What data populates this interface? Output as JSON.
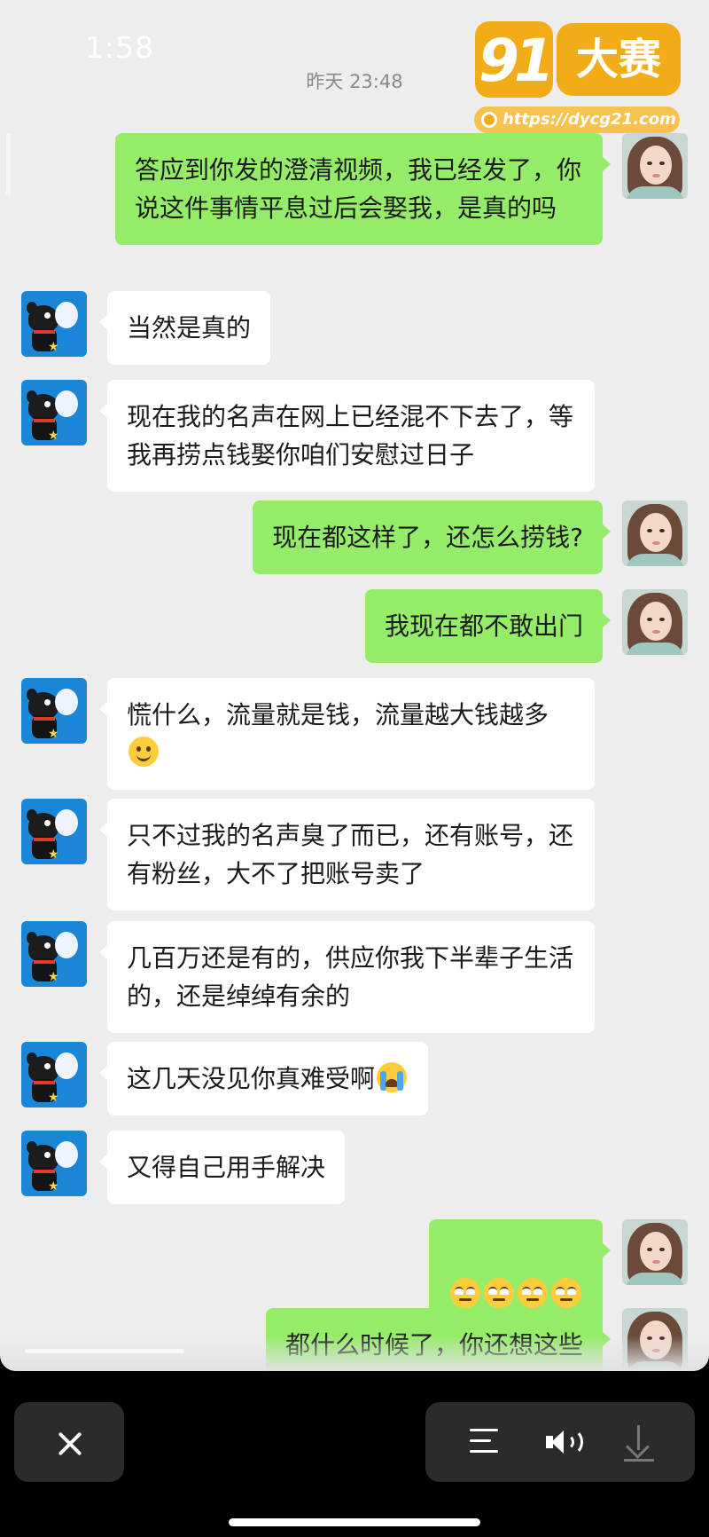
{
  "status_bar": {
    "time": "1:58"
  },
  "chat": {
    "timestamp": "昨天 23:48",
    "messages": [
      {
        "side": "out",
        "text": "答应到你发的澄清视频，我已经发了，你说这件事情平息过后会娶我，是真的吗"
      },
      {
        "side": "in",
        "text": "当然是真的"
      },
      {
        "side": "in",
        "text": "现在我的名声在网上已经混不下去了，等我再捞点钱娶你咱们安慰过日子"
      },
      {
        "side": "out",
        "text": "现在都这样了，还怎么捞钱?"
      },
      {
        "side": "out",
        "text": "我现在都不敢出门"
      },
      {
        "side": "in",
        "text": "慌什么，流量就是钱，流量越大钱越多",
        "emoji": "smile-emoji"
      },
      {
        "side": "in",
        "text": "只不过我的名声臭了而已，还有账号，还有粉丝，大不了把账号卖了"
      },
      {
        "side": "in",
        "text": "几百万还是有的，供应你我下半辈子生活的，还是绰绰有余的"
      },
      {
        "side": "in",
        "text": "这几天没见你真难受啊",
        "emoji": "crying-emoji"
      },
      {
        "side": "in",
        "text": "又得自己用手解决"
      },
      {
        "side": "out",
        "text": "",
        "emoji": "eye-roll-emoji x4"
      },
      {
        "side": "out",
        "text": "都什么时候了，你还想这些"
      }
    ]
  },
  "watermark": {
    "logo_number": "91",
    "logo_text": "大赛",
    "url": "https://dycg21.com"
  },
  "colors": {
    "incoming_bubble": "#ffffff",
    "outgoing_bubble": "#95ec69",
    "background": "#ededed",
    "logo": "#f2ac17"
  },
  "icons": [
    "close-icon",
    "menu-icon",
    "speaker-icon",
    "download-icon"
  ]
}
